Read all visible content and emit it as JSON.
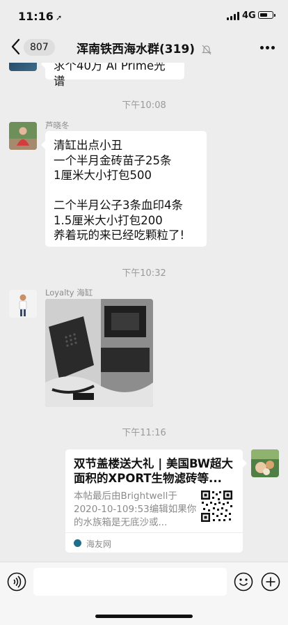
{
  "status_bar": {
    "time": "11:16",
    "network": "4G"
  },
  "nav": {
    "unread_count": "807",
    "title": "浑南铁西海水群(319)"
  },
  "messages": {
    "prev_bubble": "求个40万 Ai Prime光谱",
    "time1": "下午10:08",
    "msg1": {
      "sender": "芦晓冬",
      "text": "清缸出点小丑\n一个半月金砖苗子25条\n1厘米大小打包500\n\n二个半月公子3条血印4条\n1.5厘米大小打包200\n养着玩的来已经吃颗粒了!"
    },
    "time2": "下午10:32",
    "msg2": {
      "sender": "Loyalty 海缸"
    },
    "time3": "下午11:16",
    "card": {
      "title": "双节盖楼送大礼 | 美国BW超大面积的XPORT生物滤砖等...",
      "description": "本帖最后由Brightwell于2020-10-109:53编辑如果你的水族箱是无底沙或...",
      "source": "海友网"
    }
  }
}
